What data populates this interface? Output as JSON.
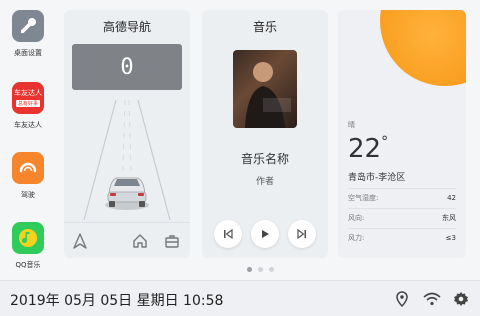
{
  "sidebar": {
    "apps": [
      {
        "label": "桌面设置",
        "icon": "wrench-icon",
        "color": "#7f8792"
      },
      {
        "label": "车友达人",
        "icon": "car-club-icon",
        "color": "#e8332e",
        "logo_text": "车友达人",
        "logo_subtext": "总有好事"
      },
      {
        "label": "驾驶",
        "icon": "gauge-icon",
        "color": "#f7852b"
      },
      {
        "label": "QQ音乐",
        "icon": "qq-music-icon",
        "color": "#2fcc5c"
      }
    ]
  },
  "navigation": {
    "title": "高德导航",
    "speed": "0"
  },
  "music": {
    "title": "音乐",
    "song": "音乐名称",
    "artist": "作者"
  },
  "weather": {
    "condition": "晴",
    "temperature": "22",
    "unit": "°",
    "location": "青岛市-李沧区",
    "rows": [
      {
        "label": "空气湿度:",
        "value": "42"
      },
      {
        "label": "风向:",
        "value": "东风"
      },
      {
        "label": "风力:",
        "value": "≤3"
      }
    ]
  },
  "pager": {
    "pages": 3,
    "active_page": 1
  },
  "status": {
    "datetime": "2019年 05月 05日 星期日 10:58"
  },
  "colors": {
    "accent_sun": "#f89a1c",
    "speed_box": "#7f8287"
  }
}
